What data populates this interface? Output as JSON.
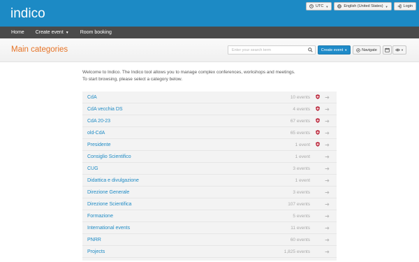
{
  "app": {
    "logo_text": "indico"
  },
  "topbar": {
    "timezone_label": "UTC",
    "language_label": "English (United States)",
    "login_label": "Login"
  },
  "nav": {
    "items": [
      {
        "label": "Home",
        "has_dropdown": false
      },
      {
        "label": "Create event",
        "has_dropdown": true
      },
      {
        "label": "Room booking",
        "has_dropdown": false
      }
    ]
  },
  "header": {
    "title": "Main categories",
    "search_placeholder": "Enter your search term",
    "create_event_label": "Create event",
    "navigate_label": "Navigate"
  },
  "welcome": {
    "line1": "Welcome to Indico. The Indico tool allows you to manage complex conferences, workshops and meetings.",
    "line2": "To start browsing, please select a category below."
  },
  "categories": [
    {
      "name": "CdA",
      "count": "10 events",
      "protected": true
    },
    {
      "name": "CdA vecchia DS",
      "count": "4 events",
      "protected": true
    },
    {
      "name": "CdA 20-23",
      "count": "67 events",
      "protected": true
    },
    {
      "name": "old-CdA",
      "count": "65 events",
      "protected": true
    },
    {
      "name": "Presidente",
      "count": "1 event",
      "protected": true
    },
    {
      "name": "Consiglio Scientifico",
      "count": "1 event",
      "protected": false
    },
    {
      "name": "CUG",
      "count": "3 events",
      "protected": false
    },
    {
      "name": "Didattica e divulgazione",
      "count": "1 event",
      "protected": false
    },
    {
      "name": "Direzione Generale",
      "count": "3 events",
      "protected": false
    },
    {
      "name": "Direzione Scientifica",
      "count": "107 events",
      "protected": false
    },
    {
      "name": "Formazione",
      "count": "5 events",
      "protected": false
    },
    {
      "name": "International events",
      "count": "11 events",
      "protected": false
    },
    {
      "name": "PNRR",
      "count": "60 events",
      "protected": false
    },
    {
      "name": "Projects",
      "count": "1,825 events",
      "protected": false
    }
  ],
  "colors": {
    "topbar": "#1c8ac5",
    "navbar": "#4a4a4a",
    "title": "#e67326",
    "link": "#1d8ac4",
    "shield": "#b3142a"
  },
  "icons": {
    "timezone": "clock-icon",
    "language": "globe-icon",
    "login": "login-icon",
    "search": "search-icon",
    "navigate": "compass-icon",
    "calendar": "calendar-icon",
    "view": "eye-icon",
    "protected": "shield-icon",
    "row_action": "arrow-right-icon"
  }
}
